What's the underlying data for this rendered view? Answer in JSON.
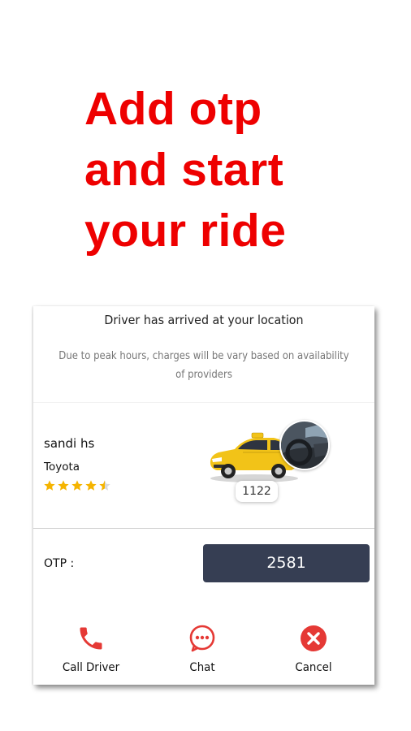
{
  "promo": {
    "lines": [
      "Add otp",
      "and start",
      "your ride"
    ]
  },
  "status": {
    "title": "Driver has arrived at your location",
    "note": "Due to peak hours, charges will be vary based on availability of providers"
  },
  "driver": {
    "name": "sandi hs",
    "car_model": "Toyota",
    "rating": 4.5,
    "plate": "1122"
  },
  "otp": {
    "label": "OTP :",
    "value": "2581"
  },
  "actions": {
    "call_label": "Call Driver",
    "chat_label": "Chat",
    "cancel_label": "Cancel"
  },
  "colors": {
    "promo_text": "#ee0000",
    "otp_background": "#363e53",
    "star": "#f5b400",
    "icon_red": "#e53935"
  },
  "icons": {
    "call": "phone-icon",
    "chat": "chat-bubble-icon",
    "cancel": "close-circle-icon",
    "rating": "star-icon"
  }
}
